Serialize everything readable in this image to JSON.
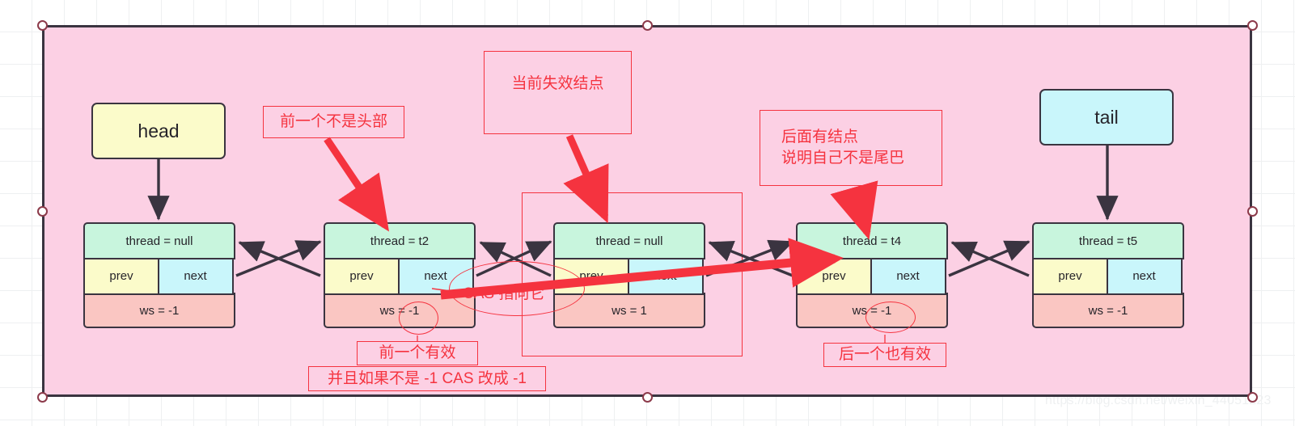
{
  "watermark": "https://blog.csdn.net/weixin_44051223",
  "pointers": {
    "head": "head",
    "tail": "tail"
  },
  "labels": {
    "prev": "prev",
    "next": "next"
  },
  "nodes": [
    {
      "id": "node-1",
      "thread": "thread = null",
      "prev": "prev",
      "next": "next",
      "ws": "ws = -1"
    },
    {
      "id": "node-2",
      "thread": "thread = t2",
      "prev": "prev",
      "next": "next",
      "ws": "ws = -1"
    },
    {
      "id": "node-3",
      "thread": "thread = null",
      "prev": "prev",
      "next": "next",
      "ws": "ws = 1"
    },
    {
      "id": "node-4",
      "thread": "thread = t4",
      "prev": "prev",
      "next": "next",
      "ws": "ws = -1"
    },
    {
      "id": "node-5",
      "thread": "thread = t5",
      "prev": "prev",
      "next": "next",
      "ws": "ws = -1"
    }
  ],
  "annotations": {
    "prev_not_head": "前一个不是头部",
    "current_invalid_node": "当前失效结点",
    "has_next_line1": "后面有结点",
    "has_next_line2": "说明自己不是尾巴",
    "prev_valid": "前一个有效",
    "cas_change_to_neg1": "并且如果不是 -1 CAS 改成 -1",
    "next_also_valid": "后一个也有效",
    "cas_point_to_it": "CAS 指向它"
  },
  "colors": {
    "container_fill": "#fcd0e4",
    "node_thread_fill": "#c8f5dd",
    "node_prev_fill": "#fbfbca",
    "node_next_fill": "#c9f6fb",
    "node_ws_fill": "#fac6c2",
    "head_fill": "#fbfbca",
    "tail_fill": "#c9f6fb",
    "stroke_dark": "#3a3440",
    "annotation_red": "#f5333f"
  }
}
